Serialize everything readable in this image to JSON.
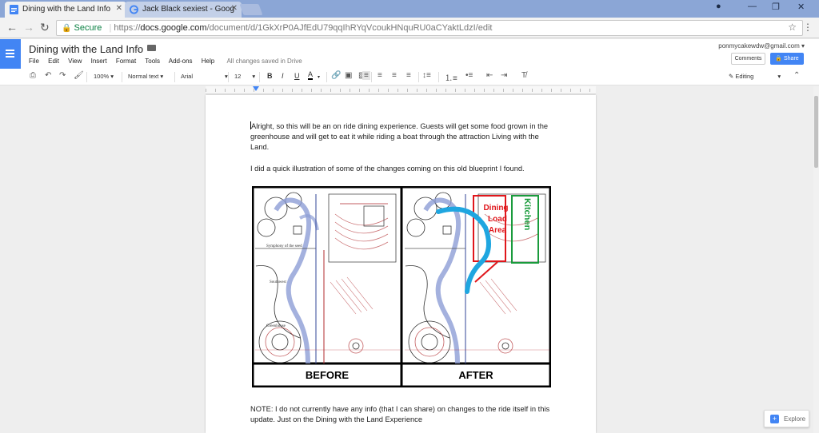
{
  "browser": {
    "tabs": [
      {
        "title": "Dining with the Land Info",
        "active": true
      },
      {
        "title": "Jack Black sexiest - Goog",
        "active": false
      }
    ],
    "secure_label": "Secure",
    "url_scheme": "https://",
    "url_host": "docs.google.com",
    "url_path": "/document/d/1GkXrP0AJfEdU79qqIhRYqVcoukHNquRU0aCYaktLdzI/edit"
  },
  "docs": {
    "title": "Dining with the Land Info",
    "menus": [
      "File",
      "Edit",
      "View",
      "Insert",
      "Format",
      "Tools",
      "Add-ons",
      "Help"
    ],
    "saved_status": "All changes saved in Drive",
    "account_email": "ponmycakewdw@gmail.com",
    "comments_label": "Comments",
    "share_label": "Share"
  },
  "toolbar": {
    "zoom": "100%",
    "style": "Normal text",
    "font": "Arial",
    "size": "12",
    "mode": "Editing"
  },
  "body": {
    "p1": "Alright, so this will be an on ride dining experience. Guests will get some food grown in the greenhouse and will get to eat it while riding a boat through the attraction Living with the Land.",
    "p2": "I did a quick illustration of some of the changes coming on this old blueprint I found.",
    "p3": "NOTE: I do not currently have any info (that I can share) on changes to the ride itself in this update. Just on the Dining with the Land Experience"
  },
  "blueprint": {
    "before_label": "BEFORE",
    "after_label": "AFTER",
    "dining_label": [
      "Dining",
      "Load",
      "Area"
    ],
    "kitchen_label": "Kitchen",
    "plan_labels": [
      "Symphony of the seed",
      "Southwest",
      "Greenhouse"
    ],
    "colors": {
      "dining": "#e0161b",
      "kitchen": "#1a9b3c",
      "track": "#1fa6e0"
    }
  },
  "explore_label": "Explore"
}
